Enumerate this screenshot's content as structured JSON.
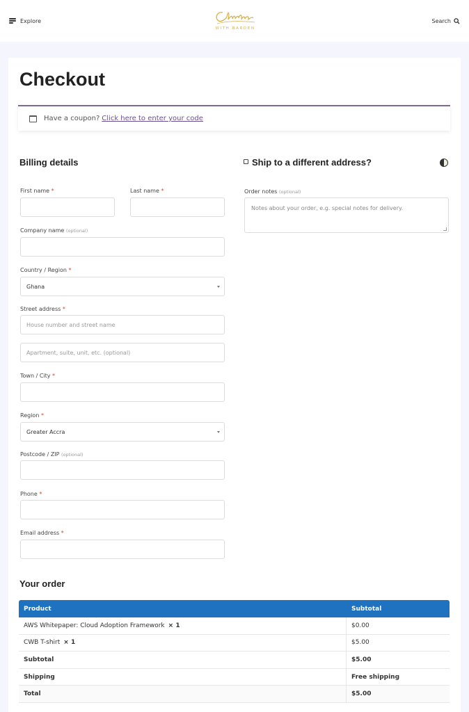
{
  "header": {
    "explore_label": "Explore",
    "logo_script": "Clouding",
    "logo_sub": "WITH BARDEN",
    "search_label": "Search"
  },
  "page": {
    "title": "Checkout"
  },
  "coupon": {
    "text": "Have a coupon?",
    "link": "Click here to enter your code"
  },
  "billing": {
    "heading": "Billing details",
    "first_name_label": "First name",
    "last_name_label": "Last name",
    "company_label": "Company name",
    "country_label": "Country / Region",
    "country_value": "Ghana",
    "street_label": "Street address",
    "street_placeholder": "House number and street name",
    "street2_placeholder": "Apartment, suite, unit, etc. (optional)",
    "town_label": "Town / City",
    "region_label": "Region",
    "region_value": "Greater Accra",
    "postcode_label": "Postcode / ZIP",
    "phone_label": "Phone",
    "email_label": "Email address",
    "required_mark": "*",
    "optional_mark": "(optional)"
  },
  "shipping": {
    "heading": "Ship to a different address?",
    "notes_label": "Order notes",
    "notes_placeholder": "Notes about your order, e.g. special notes for delivery."
  },
  "order": {
    "heading": "Your order",
    "col_product": "Product",
    "col_subtotal": "Subtotal",
    "items": [
      {
        "name": "AWS Whitepaper: Cloud Adoption Framework",
        "qty": "× 1",
        "subtotal": "$0.00"
      },
      {
        "name": "CWB T-shirt",
        "qty": "× 1",
        "subtotal": "$5.00"
      }
    ],
    "subtotal_label": "Subtotal",
    "subtotal_value": "$5.00",
    "shipping_label": "Shipping",
    "shipping_value": "Free shipping",
    "total_label": "Total",
    "total_value": "$5.00"
  },
  "colors": {
    "table_header": "#1f72c0",
    "required": "#e2401c",
    "coupon_border": "#7c6a8e",
    "logo_gold": "#d8b04a"
  }
}
